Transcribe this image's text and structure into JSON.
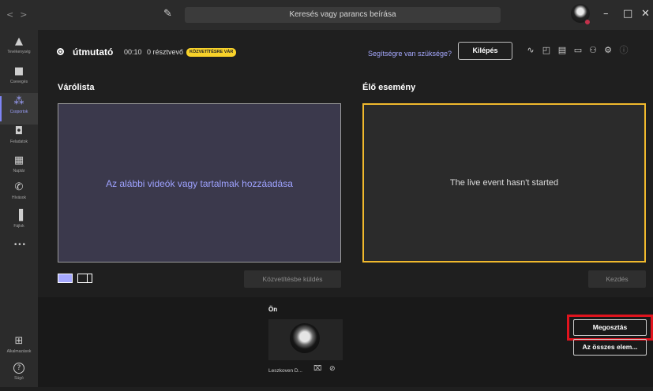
{
  "titlebar": {
    "back_glyph": "<",
    "forward_glyph": ">",
    "compose_glyph": "✎",
    "search_placeholder": "Keresés vagy parancs beírása",
    "minimize_glyph": "–",
    "maximize_glyph": "□",
    "close_glyph": "✕"
  },
  "sidebar": {
    "items": [
      {
        "label": "Tevékenység",
        "icon": "bell-icon",
        "glyph": "▲"
      },
      {
        "label": "Csevegés",
        "icon": "chat-icon",
        "glyph": "■"
      },
      {
        "label": "Csoportok",
        "icon": "teams-icon",
        "glyph": "⁂"
      },
      {
        "label": "Feladatok",
        "icon": "assignments-icon",
        "glyph": "◘"
      },
      {
        "label": "Naptár",
        "icon": "calendar-icon",
        "glyph": "▦"
      },
      {
        "label": "Hívások",
        "icon": "phone-icon",
        "glyph": "✆"
      },
      {
        "label": "Fájlok",
        "icon": "files-icon",
        "glyph": "▐"
      }
    ],
    "more_glyph": "•••",
    "apps_label": "Alkalmazások",
    "apps_glyph": "⊞",
    "help_label": "Súgó",
    "help_glyph": "?"
  },
  "event": {
    "title": "útmutató",
    "elapsed": "00:10",
    "participants": "0 résztvevő",
    "status": "KÖZVETÍTÉSRE VÁR",
    "help_link": "Segítségre van szüksége?",
    "exit_label": "Kilépés"
  },
  "toolbar_icons": [
    {
      "name": "health-icon",
      "glyph": "∿"
    },
    {
      "name": "qa-icon",
      "glyph": "◰"
    },
    {
      "name": "notes-icon",
      "glyph": "▤"
    },
    {
      "name": "chat-panel-icon",
      "glyph": "▭"
    },
    {
      "name": "people-icon",
      "glyph": "⚇"
    },
    {
      "name": "settings-icon",
      "glyph": "⚙"
    },
    {
      "name": "info-icon",
      "glyph": "ⓘ"
    }
  ],
  "queue": {
    "heading": "Várólista",
    "placeholder": "Az alábbi videók vagy tartalmak hozzáadása",
    "send_label": "Közvetítésbe küldés"
  },
  "live": {
    "heading": "Élő esemény",
    "message": "The live event hasn't started",
    "start_label": "Kezdés"
  },
  "bottom": {
    "you_label": "Ön",
    "participant_name": "Leszkoven D...",
    "cam_glyph": "⌧",
    "mic_glyph": "⊘",
    "share_label": "Megosztás",
    "all_items_label": "Az összes elem..."
  },
  "colors": {
    "accent": "#7f85f5",
    "status_yellow": "#f8d22a",
    "live_border": "#f0b92d",
    "highlight_red": "#e0141e"
  }
}
